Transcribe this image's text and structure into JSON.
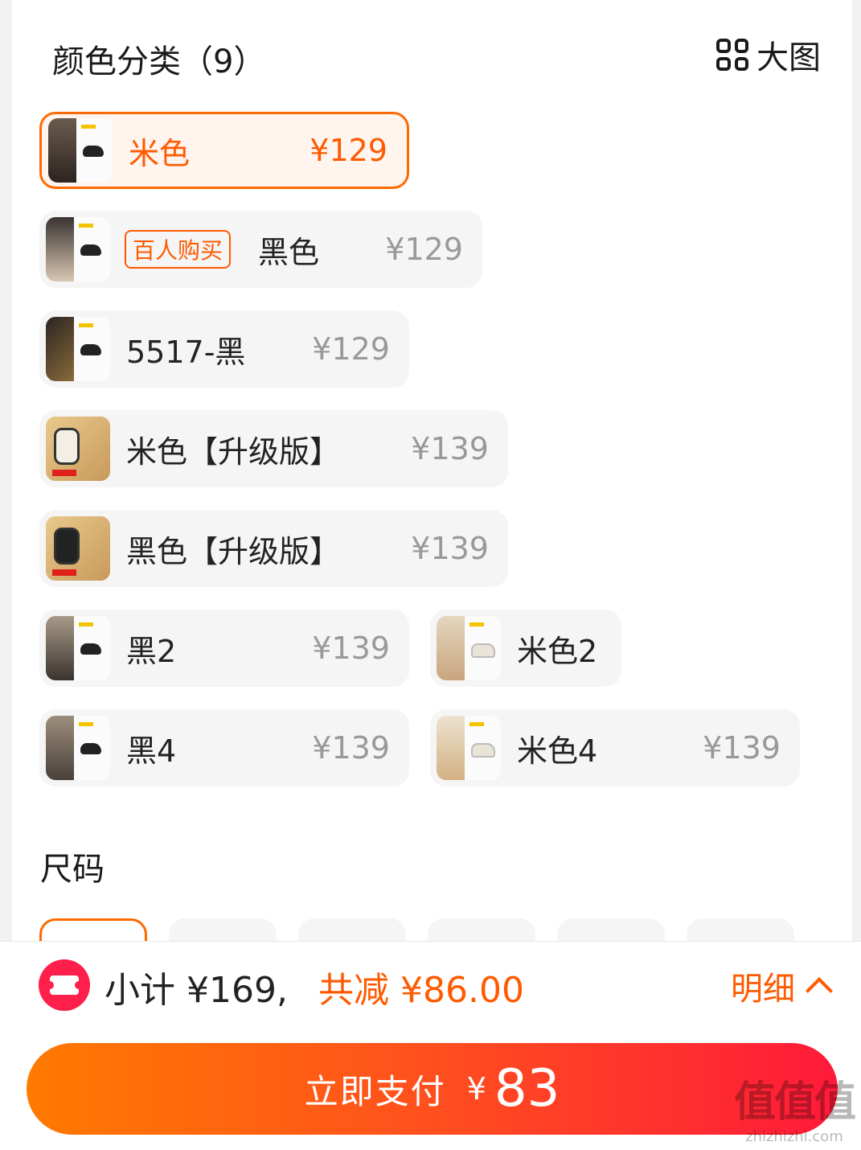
{
  "header": {
    "title": "颜色分类（9）",
    "big_view_label": "大图"
  },
  "colors": [
    {
      "name": "米色",
      "price": "¥129",
      "selected": true
    },
    {
      "name": "黑色",
      "price": "¥129",
      "badge": "百人购买"
    },
    {
      "name": "5517-黑",
      "price": "¥129"
    },
    {
      "name": "米色【升级版】",
      "price": "¥139"
    },
    {
      "name": "黑色【升级版】",
      "price": "¥139"
    },
    {
      "name": "黑2",
      "price": "¥139"
    },
    {
      "name": "米色2",
      "price": ""
    },
    {
      "name": "黑4",
      "price": "¥139"
    },
    {
      "name": "米色4",
      "price": "¥139"
    }
  ],
  "size_section": {
    "title": "尺码"
  },
  "footer": {
    "subtotal": "小计 ¥169,",
    "discount": "共减 ¥86.00",
    "detail_label": "明细",
    "pay_label": "立即支付",
    "pay_currency": "¥",
    "pay_amount": "83"
  },
  "watermark": {
    "logo_text": "值值值",
    "site": "zhizhizhi.com"
  },
  "colors_theme": {
    "accent": "#ff5a00",
    "coupon": "#ff1f4b"
  }
}
